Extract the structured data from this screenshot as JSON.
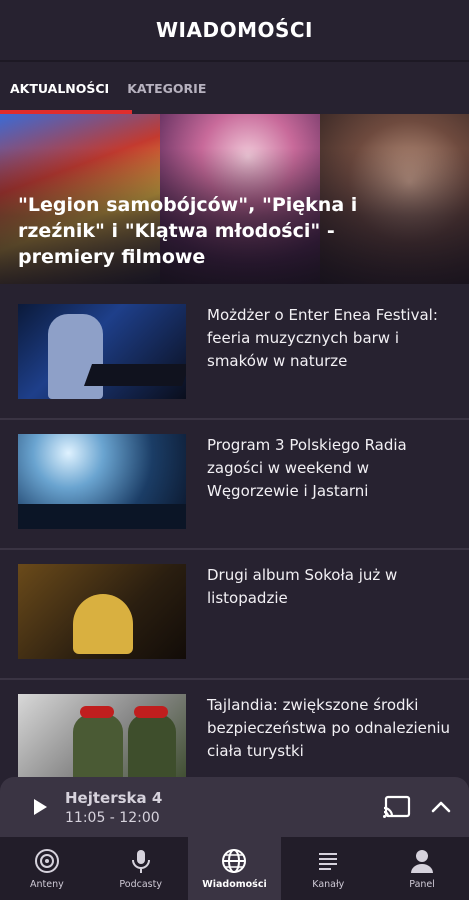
{
  "header": {
    "title": "WIADOMOŚCI"
  },
  "tabs": [
    {
      "label": "AKTUALNOŚCI",
      "active": true
    },
    {
      "label": "KATEGORIE",
      "active": false
    }
  ],
  "hero": {
    "title": "\"Legion samobójców\", \"Piękna i rzeźnik\" i \"Klątwa młodości\" - premiery filmowe"
  },
  "news": [
    {
      "title": "Możdżer o Enter Enea Festival: feeria muzycznych barw i smaków w naturze"
    },
    {
      "title": "Program 3 Polskiego Radia zagości w weekend w Węgorzewie i Jastarni"
    },
    {
      "title": "Drugi album Sokoła już w listopadzie"
    },
    {
      "title": "Tajlandia: zwiększone środki bezpieczeństwa po odnalezieniu ciała turystki"
    }
  ],
  "player": {
    "title": "Hejterska 4",
    "time": "11:05 - 12:00"
  },
  "nav": [
    {
      "label": "Anteny",
      "icon": "radio-waves-icon",
      "active": false
    },
    {
      "label": "Podcasty",
      "icon": "microphone-icon",
      "active": false
    },
    {
      "label": "Wiadomości",
      "icon": "globe-icon",
      "active": true
    },
    {
      "label": "Kanały",
      "icon": "list-icon",
      "active": false
    },
    {
      "label": "Panel",
      "icon": "person-icon",
      "active": false
    }
  ],
  "colors": {
    "background": "#272230",
    "accent": "#e02d2d",
    "player_bg": "#3a3443",
    "nav_bg": "#221d29"
  }
}
